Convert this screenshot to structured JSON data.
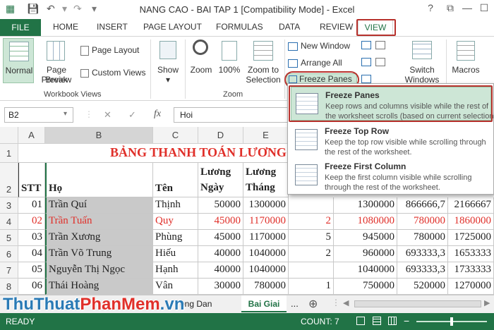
{
  "window": {
    "title": "NANG CAO - BAI TAP 1  [Compatibility Mode] - Excel",
    "help": "?",
    "restore": "⧉",
    "minimize": "—",
    "maximize": "☐",
    "close": "✕"
  },
  "quick_access": [
    "save-icon",
    "undo-icon",
    "redo-icon",
    "customize-icon"
  ],
  "tabs": {
    "file": "FILE",
    "home": "HOME",
    "insert": "INSERT",
    "page_layout": "PAGE LAYOUT",
    "formulas": "FORMULAS",
    "data": "DATA",
    "review": "REVIEW",
    "view": "VIEW"
  },
  "ribbon": {
    "normal": "Normal",
    "page_break_1": "Page Break",
    "page_break_2": "Preview",
    "page_layout": "Page Layout",
    "custom_views": "Custom Views",
    "show": "Show",
    "zoom": "Zoom",
    "zoom100": "100%",
    "zoom_to_1": "Zoom to",
    "zoom_to_2": "Selection",
    "new_window": "New Window",
    "arrange_all": "Arrange All",
    "freeze_panes": "Freeze Panes",
    "switch_1": "Switch",
    "switch_2": "Windows",
    "macros": "Macros",
    "group_workbook_views": "Workbook Views",
    "group_zoom": "Zoom"
  },
  "formula_bar": {
    "name_box": "B2",
    "cancel": "✕",
    "enter": "✓",
    "fx": "fx",
    "value": "Hoi"
  },
  "dropdown": [
    {
      "title": "Freeze Panes",
      "desc1": "Keep rows and columns visible while the rest of",
      "desc2": "the worksheet scrolls (based on current selection)."
    },
    {
      "title": "Freeze Top Row",
      "desc1": "Keep the top row visible while scrolling through",
      "desc2": "the rest of the worksheet."
    },
    {
      "title": "Freeze First Column",
      "desc1": "Keep the first column visible while scrolling",
      "desc2": "through the rest of the worksheet."
    }
  ],
  "grid": {
    "columns": [
      "A",
      "B",
      "C",
      "D",
      "E"
    ],
    "rows": [
      "1",
      "2",
      "3",
      "4",
      "5",
      "6",
      "7",
      "8"
    ],
    "banner": "BẢNG THANH TOÁN LƯƠNG",
    "headers": {
      "stt": "STT",
      "ho": "Họ",
      "ten": "Tên",
      "luong_ngay_1": "Lương",
      "luong_ngay_2": "Ngày",
      "luong_thang_1": "Lương",
      "luong_thang_2": "Tháng"
    },
    "data": [
      {
        "stt": "01",
        "ho": "Trần Quí",
        "ten": "Thịnh",
        "ngay": "50000",
        "thang": "1300000",
        "f": "",
        "g": "1300000",
        "h": "866666,7",
        "i": "2166667",
        "red": false
      },
      {
        "stt": "02",
        "ho": "Trần Tuấn",
        "ten": "Quy",
        "ngay": "45000",
        "thang": "1170000",
        "f": "2",
        "g": "1080000",
        "h": "780000",
        "i": "1860000",
        "red": true
      },
      {
        "stt": "03",
        "ho": "Trần Xương",
        "ten": "Phùng",
        "ngay": "45000",
        "thang": "1170000",
        "f": "5",
        "g": "945000",
        "h": "780000",
        "i": "1725000",
        "red": false
      },
      {
        "stt": "04",
        "ho": "Trần Võ Trung",
        "ten": "Hiếu",
        "ngay": "40000",
        "thang": "1040000",
        "f": "2",
        "g": "960000",
        "h": "693333,3",
        "i": "1653333",
        "red": false
      },
      {
        "stt": "05",
        "ho": "Nguyễn Thị Ngọc",
        "ten": "Hạnh",
        "ngay": "40000",
        "thang": "1040000",
        "f": "",
        "g": "1040000",
        "h": "693333,3",
        "i": "1733333",
        "red": false
      },
      {
        "stt": "06",
        "ho": "Thái Hoàng",
        "ten": "Vân",
        "ngay": "30000",
        "thang": "780000",
        "f": "1",
        "g": "750000",
        "h": "520000",
        "i": "1270000",
        "red": false
      }
    ]
  },
  "sheets": {
    "tab1": "ong Dan",
    "tab2": "Bai Giai",
    "more": "...",
    "add": "⊕"
  },
  "status": {
    "ready": "READY",
    "count": "COUNT: 7"
  },
  "watermark": {
    "part1": "ThuThuat",
    "part2": "PhanMem",
    "part3": ".vn"
  },
  "colors": {
    "excel_green": "#217346",
    "highlight_red": "#e0302a",
    "selection_gray": "#c9c9c9"
  }
}
